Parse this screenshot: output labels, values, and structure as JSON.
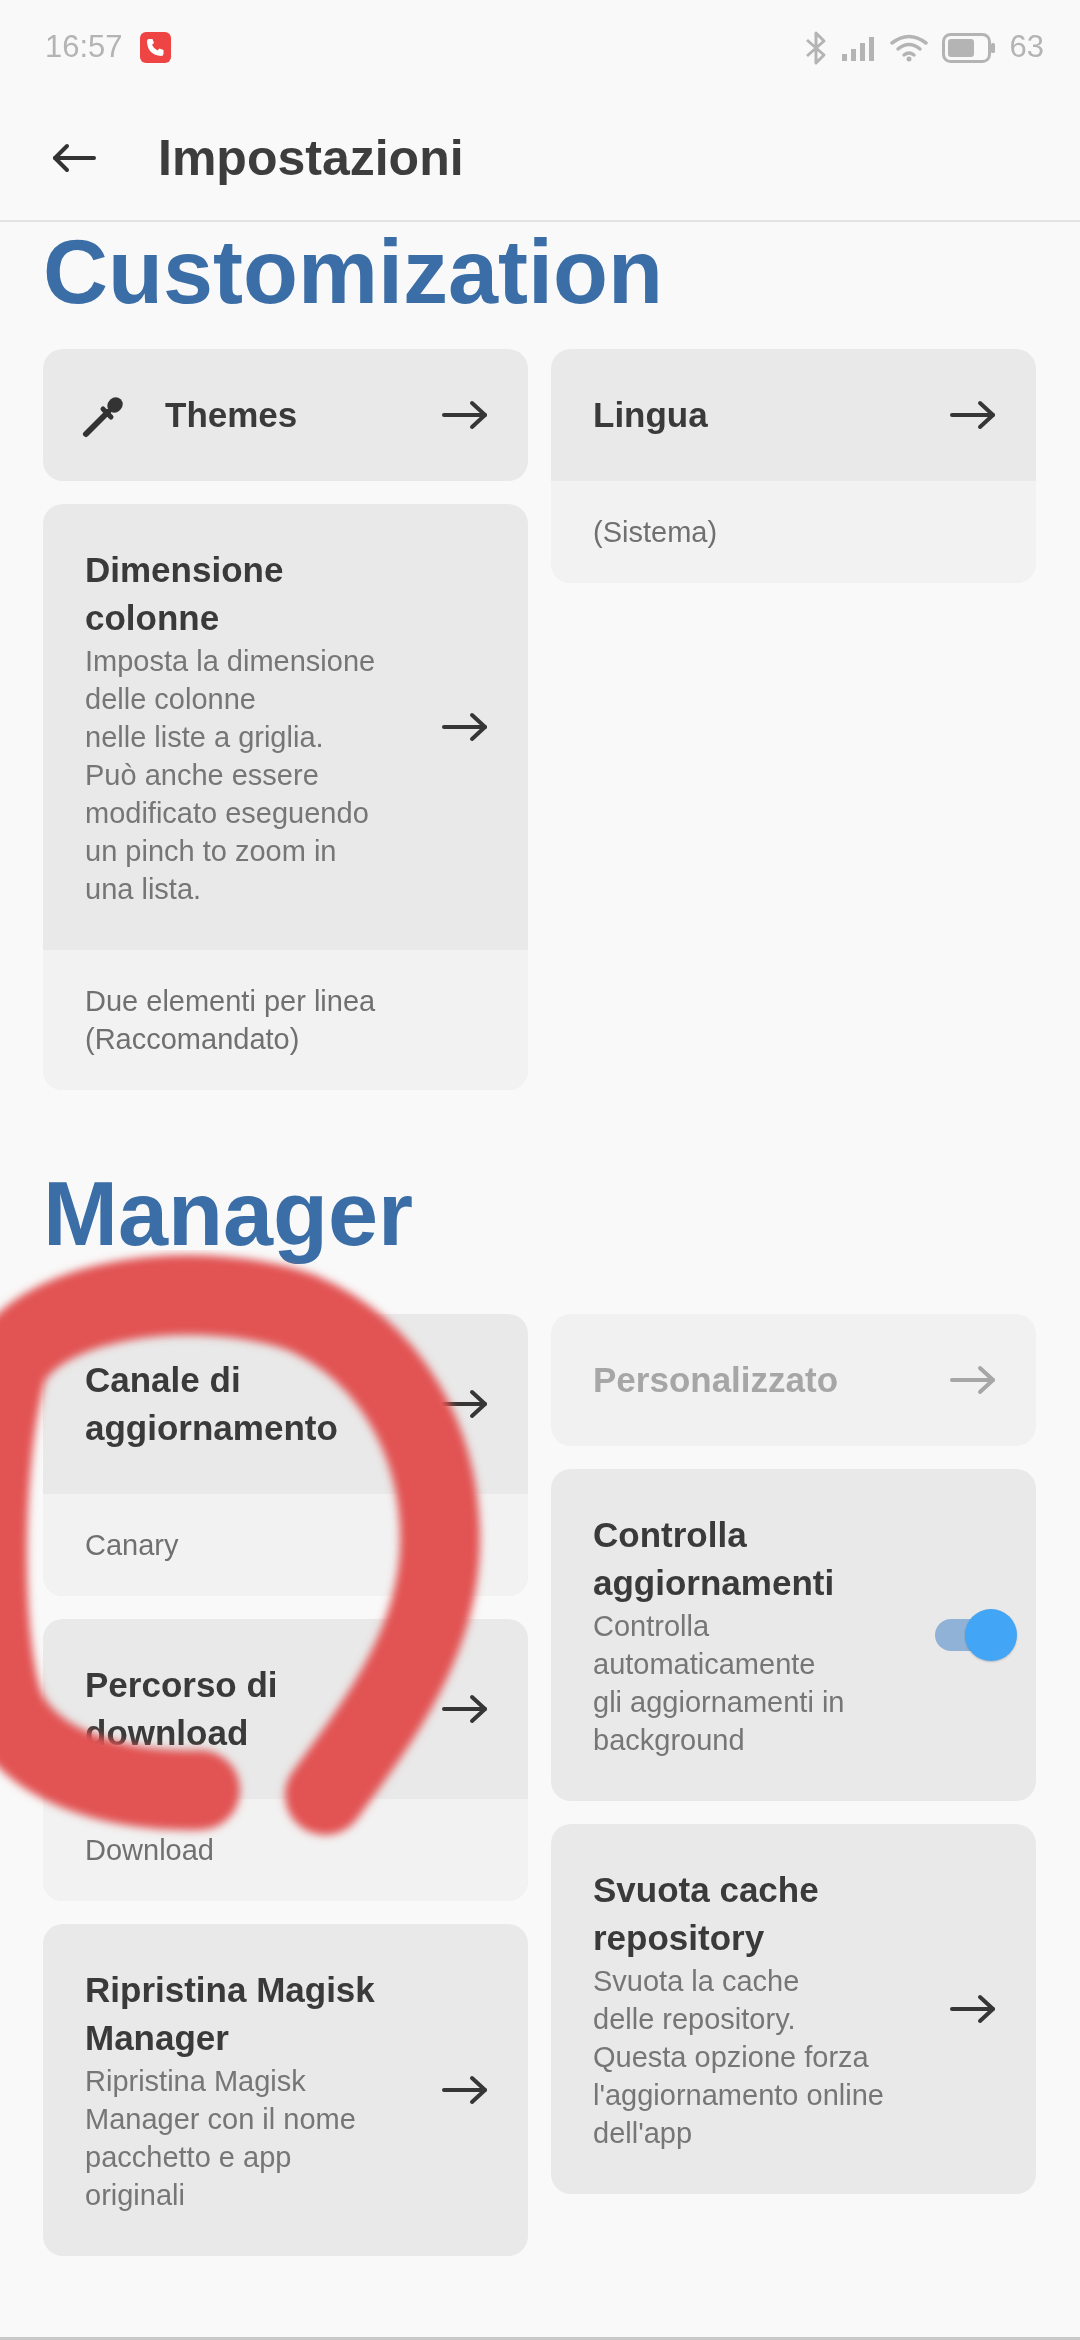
{
  "status_bar": {
    "time": "16:57",
    "battery": "63"
  },
  "app_bar": {
    "title": "Impostazioni"
  },
  "sections": [
    {
      "title": "Customization",
      "columns": [
        [
          {
            "kind": "icon_link",
            "title": "Themes",
            "disabled": false
          },
          {
            "kind": "link",
            "title": "Dimensione\ncolonne",
            "description": "Imposta la dimensione\ndelle colonne\nnelle liste a griglia.\nPuò anche essere\nmodificato eseguendo\nun pinch to zoom in\nuna lista.",
            "value": "Due elementi per linea\n(Raccomandato)",
            "disabled": false
          }
        ],
        [
          {
            "kind": "link",
            "title": "Lingua",
            "value": "(Sistema)",
            "disabled": false
          }
        ]
      ]
    },
    {
      "title": "Manager",
      "columns": [
        [
          {
            "kind": "link",
            "title": "Canale di\naggiornamento",
            "value": "Canary",
            "disabled": false
          },
          {
            "kind": "link",
            "title": "Percorso di\ndownload",
            "value": "Download",
            "disabled": false
          },
          {
            "kind": "link",
            "title": "Ripristina Magisk\nManager",
            "description": "Ripristina Magisk\nManager con il nome\npacchetto e app\noriginali",
            "disabled": false
          }
        ],
        [
          {
            "kind": "link",
            "title": "Personalizzato",
            "disabled": true
          },
          {
            "kind": "toggle",
            "title": "Controlla\naggiornamenti",
            "description": "Controlla\nautomaticamente\ngli aggiornamenti in\nbackground",
            "on": true,
            "disabled": false
          },
          {
            "kind": "link",
            "title": "Svuota cache\nrepository",
            "description": "Svuota la cache\ndelle repository.\nQuesta opzione forza\nl'aggiornamento online\ndell'app",
            "disabled": false
          }
        ]
      ]
    }
  ]
}
